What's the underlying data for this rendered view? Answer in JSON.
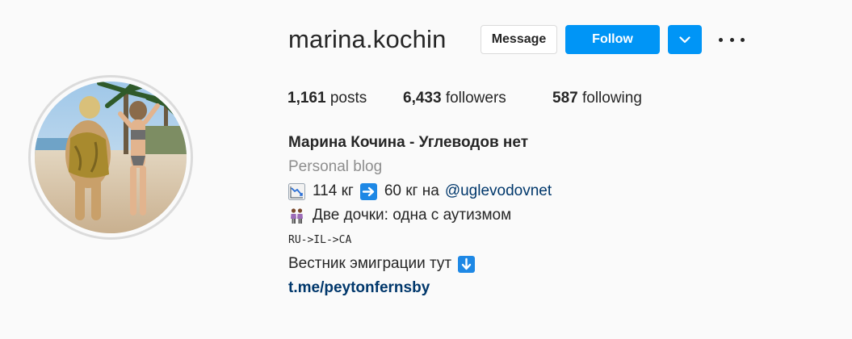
{
  "profile": {
    "username": "marina.kochin",
    "message_label": "Message",
    "follow_label": "Follow"
  },
  "stats": {
    "posts_count": "1,161",
    "posts_label": "posts",
    "followers_count": "6,433",
    "followers_label": "followers",
    "following_count": "587",
    "following_label": "following"
  },
  "bio": {
    "name": "Марина Кочина - Углеводов нет",
    "category": "Personal blog",
    "weight_from": "114 кг",
    "weight_to": "60 кг на",
    "mention": "@uglevodovnet",
    "daughters": "Две дочки: одна с аутизмом",
    "route": "RU->IL->CA",
    "emigration": "Вестник эмиграции тут",
    "link": "t.me/peytonfernsby"
  },
  "colors": {
    "accent": "#0095f6",
    "link": "#00376b",
    "muted": "#8e8e8e",
    "text": "#262626"
  },
  "icons": [
    "chart-decreasing-icon",
    "right-arrow-icon",
    "two-women-icon",
    "down-arrow-icon",
    "chevron-down-icon",
    "more-options-icon"
  ]
}
